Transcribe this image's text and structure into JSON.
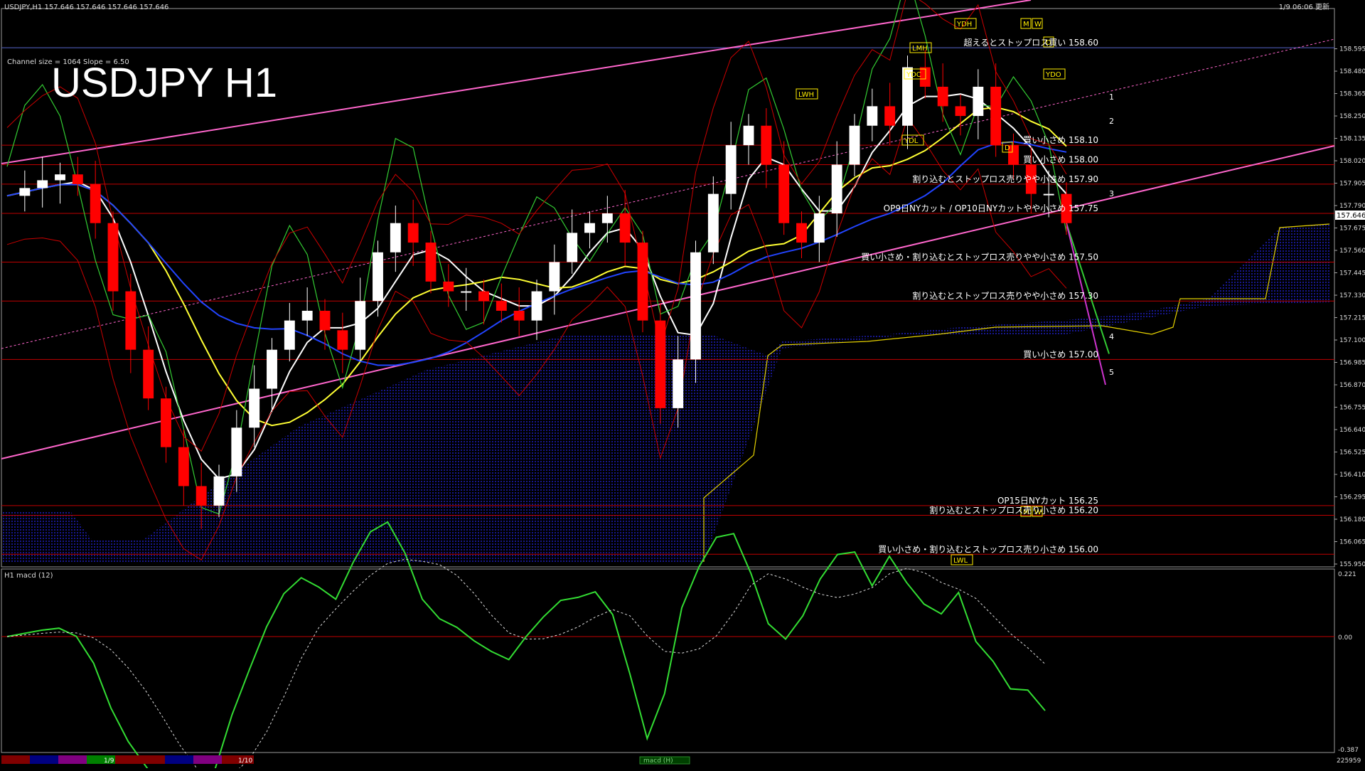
{
  "header": {
    "symbol_info": "USDJPY,H1  157.646 157.646 157.646 157.646",
    "updated": "1/9 06:06 更新",
    "channel_info": "Channel size = 1064 Slope = 6.50",
    "big_title": "USDJPY H1"
  },
  "macd_panel": {
    "label": "H1  macd (12)",
    "ticks": [
      "0.221",
      "0.00",
      "-0.387"
    ],
    "footer_id": "225959",
    "bottom_tab": "macd (H)"
  },
  "timeline": {
    "labels": [
      "1/9",
      "1/10"
    ]
  },
  "price_tag": "157.646",
  "level_notes": [
    {
      "text": "超えるとストップロス買い 158.60",
      "price": 158.6
    },
    {
      "text": "買い小さめ 158.10",
      "price": 158.1
    },
    {
      "text": "買い小さめ 158.00",
      "price": 158.0
    },
    {
      "text": "割り込むとストップロス売りやや小さめ 157.90",
      "price": 157.9
    },
    {
      "text": "OP9日NYカット / OP10日NYカットやや小さめ 157.75",
      "price": 157.75
    },
    {
      "text": "買い小さめ・割り込むとストップロス売りやや小さめ 157.50",
      "price": 157.5
    },
    {
      "text": "割り込むとストップロス売りやや小さめ 157.30",
      "price": 157.3
    },
    {
      "text": "買い小さめ 157.00",
      "price": 157.0
    },
    {
      "text": "OP15日NYカット 156.25",
      "price": 156.25
    },
    {
      "text": "割り込むとストップロス売り小さめ 156.20",
      "price": 156.2
    },
    {
      "text": "買い小さめ・割り込むとストップロス売り小さめ 156.00",
      "price": 156.0
    }
  ],
  "markers": {
    "boxes": [
      "YDH",
      "M",
      "W",
      "D",
      "YDC",
      "YDO",
      "YDL",
      "LMH",
      "LWH",
      "D",
      "M",
      "W",
      "LWL"
    ],
    "wave_numbers": [
      "1",
      "2",
      "3",
      "4",
      "5"
    ]
  },
  "colors": {
    "bg": "#000000",
    "up_candle": "#ffffff",
    "down_candle": "#ff0000",
    "level_line": "#c00000",
    "channel": "#ff66cc",
    "ma_white": "#ffffff",
    "ma_yellow": "#ffff33",
    "ma_blue": "#2244ff",
    "rsi_green": "#33cc33",
    "cloud": "#1a1aa0",
    "macd_up": "#33dd33",
    "macd_down": "#ff7799",
    "label_text": "#ffffff",
    "marker_yellow": "#ffee00"
  },
  "chart_data": {
    "type": "line",
    "title": "USDJPY H1",
    "xlabel": "",
    "ylabel": "",
    "ylim": [
      155.95,
      158.67
    ],
    "y_ticks": [
      "158.595",
      "158.480",
      "158.365",
      "158.250",
      "158.135",
      "158.020",
      "157.905",
      "157.790",
      "157.675",
      "157.560",
      "157.445",
      "157.330",
      "157.215",
      "157.100",
      "156.985",
      "156.870",
      "156.755",
      "156.640",
      "156.525",
      "156.410",
      "156.295",
      "156.180",
      "156.065",
      "155.950"
    ],
    "current_price": 157.646,
    "series": [
      {
        "name": "",
        "values": [
          157.84,
          157.88,
          157.92,
          157.95,
          157.9,
          157.7,
          157.35,
          157.05,
          156.8,
          156.55,
          156.35,
          156.25,
          156.4,
          156.65,
          156.85,
          157.05,
          157.2,
          157.25,
          157.15,
          157.05,
          157.3,
          157.55,
          157.7,
          157.6,
          157.4,
          157.35,
          157.35,
          157.3,
          157.25,
          157.2,
          157.35,
          157.5,
          157.65,
          157.7,
          157.75,
          157.6,
          157.2,
          156.75,
          157.0,
          157.55,
          157.85,
          158.1,
          158.2,
          158.0,
          157.7,
          157.6,
          157.75,
          158.0,
          158.2,
          158.3,
          158.2,
          158.5,
          158.4,
          158.3,
          158.25,
          158.4,
          158.1,
          158.0,
          157.85,
          157.85,
          157.7
        ]
      }
    ]
  }
}
